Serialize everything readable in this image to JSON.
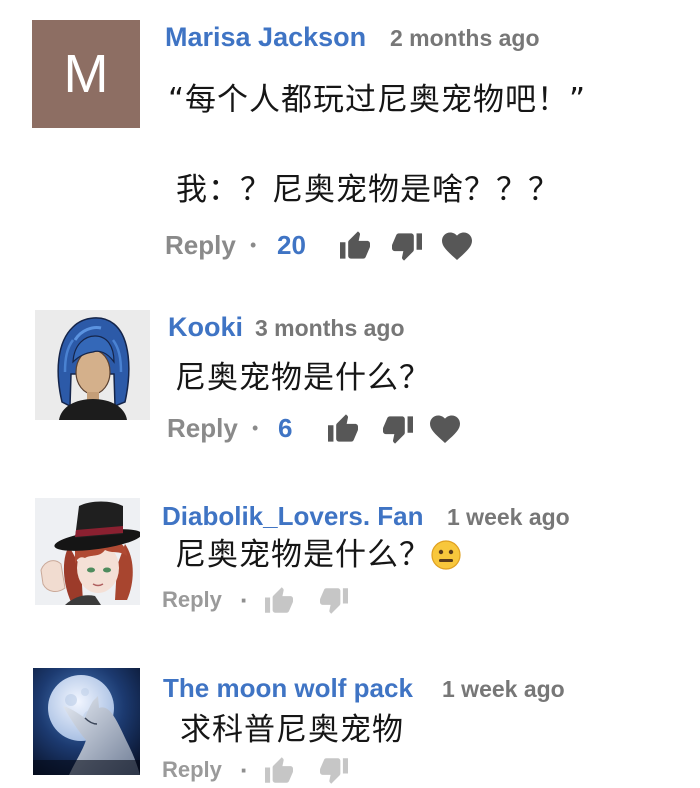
{
  "colors": {
    "name": "#3f74c4",
    "meta": "#777777",
    "text": "#161616",
    "action": "#8a8a8a",
    "count": "#3f74c4",
    "icon": "#575757",
    "icon_faint": "#c6c6c6"
  },
  "comments": [
    {
      "author": "Marisa Jackson",
      "time": "2 months ago",
      "avatar": {
        "letter": "M",
        "color": "#8d6e63"
      },
      "lines": [
        "“每个人都玩过尼奥宠物吧！”",
        "我：？尼奥宠物是啥？？？"
      ],
      "actions": {
        "reply_label": "Reply",
        "separator": "•",
        "like_count": "20",
        "icons": [
          "thumbs-up-icon",
          "thumbs-down-icon",
          "heart-icon"
        ]
      }
    },
    {
      "author": "Kooki",
      "time": "3 months ago",
      "avatar": {
        "icon": "cartoon-blue-hair-avatar-icon"
      },
      "lines": [
        "尼奥宠物是什么？"
      ],
      "actions": {
        "reply_label": "Reply",
        "separator": "•",
        "like_count": "6",
        "icons": [
          "thumbs-up-icon",
          "thumbs-down-icon",
          "heart-icon"
        ]
      }
    },
    {
      "author": "Diabolik_Lovers. Fan",
      "time": "1 week ago",
      "avatar": {
        "icon": "anime-character-top-hat-avatar-icon"
      },
      "lines": [
        "尼奥宠物是什么？"
      ],
      "emoji": "neutral-face-emoji-icon",
      "actions": {
        "reply_label": "Reply",
        "separator": "·",
        "icons": [
          "thumbs-up-icon",
          "thumbs-down-icon"
        ]
      }
    },
    {
      "author": "The moon wolf pack",
      "time": "1 week ago",
      "avatar": {
        "icon": "howling-wolf-moon-avatar-icon"
      },
      "lines": [
        "求科普尼奥宠物"
      ],
      "actions": {
        "reply_label": "Reply",
        "separator": "·",
        "icons": [
          "thumbs-up-icon",
          "thumbs-down-icon"
        ]
      }
    }
  ]
}
